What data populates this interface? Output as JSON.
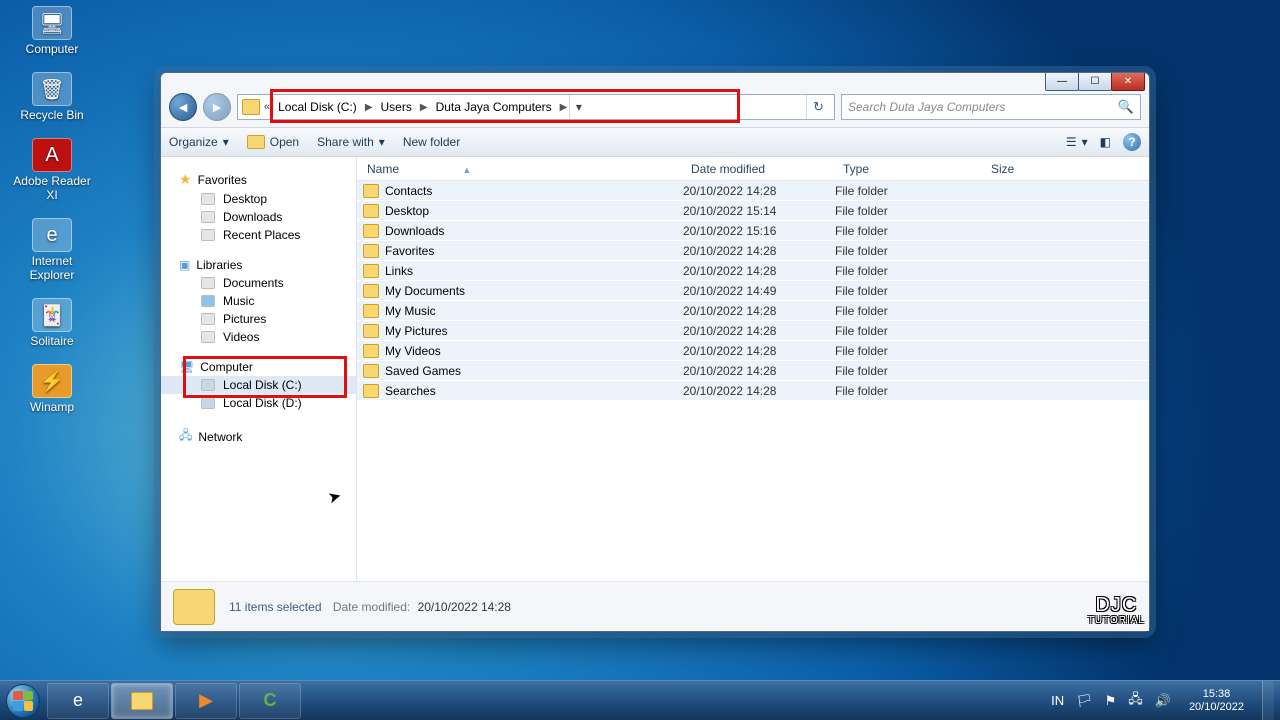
{
  "desktop_icons": [
    {
      "label": "Computer"
    },
    {
      "label": "Recycle Bin"
    },
    {
      "label": "Adobe Reader XI"
    },
    {
      "label": "Internet Explorer"
    },
    {
      "label": "Solitaire"
    },
    {
      "label": "Winamp"
    }
  ],
  "breadcrumb": {
    "segments": [
      "Local Disk (C:)",
      "Users",
      "Duta Jaya Computers"
    ]
  },
  "search": {
    "placeholder": "Search Duta Jaya Computers"
  },
  "toolbar": {
    "organize": "Organize",
    "open": "Open",
    "share": "Share with",
    "newfolder": "New folder"
  },
  "nav": {
    "favorites": {
      "header": "Favorites",
      "items": [
        "Desktop",
        "Downloads",
        "Recent Places"
      ]
    },
    "libraries": {
      "header": "Libraries",
      "items": [
        "Documents",
        "Music",
        "Pictures",
        "Videos"
      ]
    },
    "computer": {
      "header": "Computer",
      "items": [
        "Local Disk (C:)",
        "Local Disk (D:)"
      ]
    },
    "network": {
      "header": "Network"
    }
  },
  "columns": {
    "name": "Name",
    "date": "Date modified",
    "type": "Type",
    "size": "Size"
  },
  "files": [
    {
      "name": "Contacts",
      "date": "20/10/2022 14:28",
      "type": "File folder"
    },
    {
      "name": "Desktop",
      "date": "20/10/2022 15:14",
      "type": "File folder"
    },
    {
      "name": "Downloads",
      "date": "20/10/2022 15:16",
      "type": "File folder"
    },
    {
      "name": "Favorites",
      "date": "20/10/2022 14:28",
      "type": "File folder"
    },
    {
      "name": "Links",
      "date": "20/10/2022 14:28",
      "type": "File folder"
    },
    {
      "name": "My Documents",
      "date": "20/10/2022 14:49",
      "type": "File folder"
    },
    {
      "name": "My Music",
      "date": "20/10/2022 14:28",
      "type": "File folder"
    },
    {
      "name": "My Pictures",
      "date": "20/10/2022 14:28",
      "type": "File folder"
    },
    {
      "name": "My Videos",
      "date": "20/10/2022 14:28",
      "type": "File folder"
    },
    {
      "name": "Saved Games",
      "date": "20/10/2022 14:28",
      "type": "File folder"
    },
    {
      "name": "Searches",
      "date": "20/10/2022 14:28",
      "type": "File folder"
    }
  ],
  "status": {
    "selected": "11 items selected",
    "dm_label": "Date modified:",
    "dm_value": "20/10/2022 14:28"
  },
  "systray": {
    "lang": "IN",
    "time": "15:38",
    "date": "20/10/2022"
  },
  "logo": {
    "line1": "DJC",
    "line2": "TUTORIAL"
  }
}
